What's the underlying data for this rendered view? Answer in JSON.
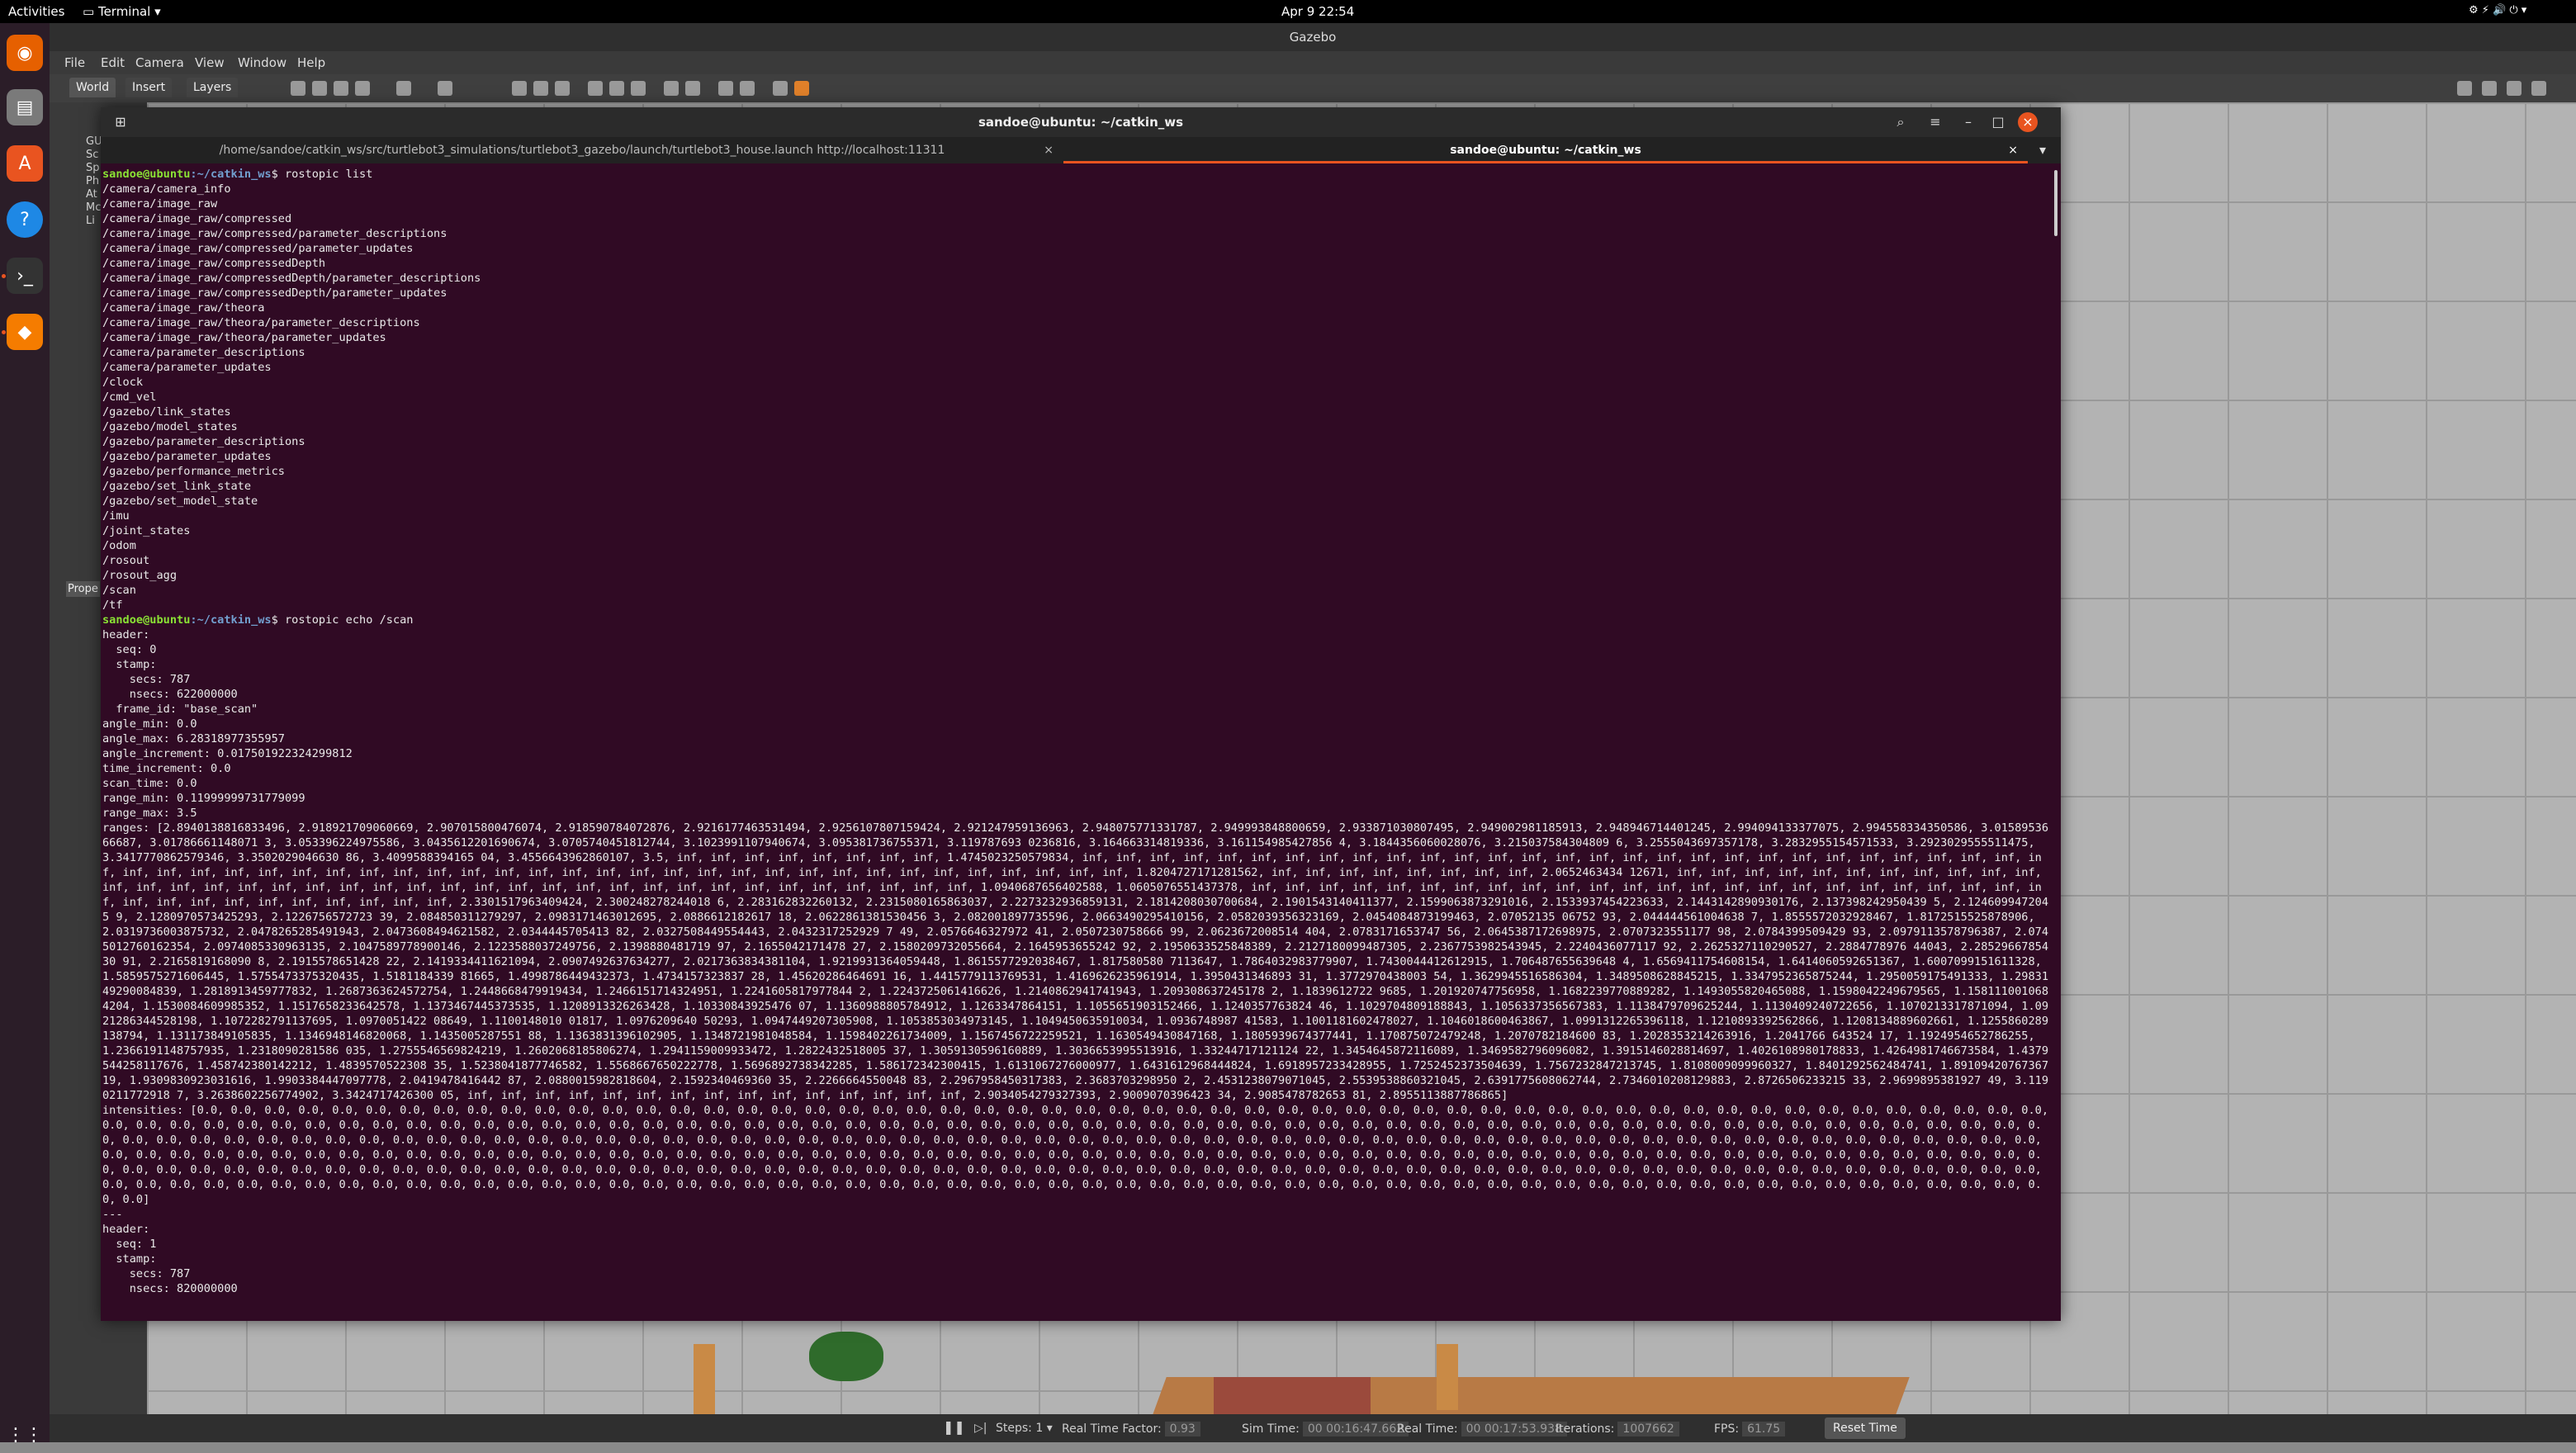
{
  "topbar": {
    "activities": "Activities",
    "app_menu": "Terminal ▾",
    "datetime": "Apr 9  22:54"
  },
  "gazebo": {
    "title": "Gazebo",
    "menus": [
      "File",
      "Edit",
      "Camera",
      "View",
      "Window",
      "Help"
    ],
    "tabs": [
      "World",
      "Insert",
      "Layers"
    ],
    "left_panel_items": [
      "GU",
      "Sc",
      "Sp",
      "Ph",
      "At",
      "Mc",
      "Li"
    ],
    "left_panel_label": "Prope",
    "status": {
      "steps_label": "Steps:",
      "steps_value": "1",
      "rtf_label": "Real Time Factor:",
      "rtf_value": "0.93",
      "sim_time_label": "Sim Time:",
      "sim_time_value": "00 00:16:47.662",
      "real_time_label": "Real Time:",
      "real_time_value": "00 00:17:53.938",
      "iterations_label": "Iterations:",
      "iterations_value": "1007662",
      "fps_label": "FPS:",
      "fps_value": "61.75",
      "reset_label": "Reset Time"
    }
  },
  "terminal": {
    "title": "sandoe@ubuntu: ~/catkin_ws",
    "tab1": "/home/sandoe/catkin_ws/src/turtlebot3_simulations/turtlebot3_gazebo/launch/turtlebot3_house.launch http://localhost:11311",
    "tab2": "sandoe@ubuntu: ~/catkin_ws",
    "prompt_user": "sandoe@ubuntu",
    "prompt_path": ":~/catkin_ws",
    "cmd1": "$ rostopic list",
    "topics": "/camera/camera_info\n/camera/image_raw\n/camera/image_raw/compressed\n/camera/image_raw/compressed/parameter_descriptions\n/camera/image_raw/compressed/parameter_updates\n/camera/image_raw/compressedDepth\n/camera/image_raw/compressedDepth/parameter_descriptions\n/camera/image_raw/compressedDepth/parameter_updates\n/camera/image_raw/theora\n/camera/image_raw/theora/parameter_descriptions\n/camera/image_raw/theora/parameter_updates\n/camera/parameter_descriptions\n/camera/parameter_updates\n/clock\n/cmd_vel\n/gazebo/link_states\n/gazebo/model_states\n/gazebo/parameter_descriptions\n/gazebo/parameter_updates\n/gazebo/performance_metrics\n/gazebo/set_link_state\n/gazebo/set_model_state\n/imu\n/joint_states\n/odom\n/rosout\n/rosout_agg\n/scan\n/tf",
    "cmd2": "$ rostopic echo /scan",
    "header1": "header:\n  seq: 0\n  stamp:\n    secs: 787\n    nsecs: 622000000\n  frame_id: \"base_scan\"\nangle_min: 0.0\nangle_max: 6.28318977355957\nangle_increment: 0.017501922324299812\ntime_increment: 0.0\nscan_time: 0.0\nrange_min: 0.11999999731779099\nrange_max: 3.5",
    "ranges": "ranges: [2.8940138816833496, 2.918921709060669, 2.907015800476074, 2.918590784072876, 2.9216177463531494, 2.9256107807159424, 2.921247959136963, 2.948075771331787, 2.949993848800659, 2.933871030807495, 2.949002981185913, 2.948946714401245, 2.994094133377075, 2.994558334350586, 3.0158953666687, 3.01786661148071 3, 3.053396224975586, 3.0435612201690674, 3.0705740451812744, 3.1023991107940674, 3.095381736755371, 3.119787693 0236816, 3.164663314819336, 3.161154985427856 4, 3.1844356060028076, 3.215037584304809 6, 3.2555043697357178, 3.2832955154571533, 3.2923029555511475, 3.3417770862579346, 3.3502029046630 86, 3.4099588394165 04, 3.4556643962860107, 3.5, inf, inf, inf, inf, inf, inf, inf, inf, 1.4745023250579834, inf, inf, inf, inf, inf, inf, inf, inf, inf, inf, inf, inf, inf, inf, inf, inf, inf, inf, inf, inf, inf, inf, inf, inf, inf, inf, inf, inf, inf, inf, inf, inf, inf, inf, inf, inf, inf, inf, inf, inf, inf, inf, inf, inf, inf, inf, inf, inf, inf, inf, inf, inf, inf, inf, inf, inf, inf, inf, inf, 1.8204727171281562, inf, inf, inf, inf, inf, inf, inf, inf, 2.0652463434 12671, inf, inf, inf, inf, inf, inf, inf, inf, inf, inf, inf, inf, inf, inf, inf, inf, inf, inf, inf, inf, inf, inf, inf, inf, inf, inf, inf, inf, inf, inf, inf, inf, inf, inf, inf, inf, inf, 1.0940687656402588, 1.0605076551437378, inf, inf, inf, inf, inf, inf, inf, inf, inf, inf, inf, inf, inf, inf, inf, inf, inf, inf, inf, inf, inf, inf, inf, inf, inf, inf, inf, inf, inf, inf, inf, inf, inf, inf, 2.3301517963409424, 2.300248278244018 6, 2.283162832260132, 2.2315080165863037, 2.2273232936859131, 2.1814208030700684, 2.1901543140411377, 2.1599063873291016, 2.1533937454223633, 2.1443142890930176, 2.137398242950439 5, 2.1246099472045 9, 2.1280970573425293, 2.1226756572723 39, 2.084850311279297, 2.0983171463012695, 2.0886612182617 18, 2.0622861381530456 3, 2.082001897735596, 2.0663490295410156, 2.0582039356323169, 2.0454084873199463, 2.07052135 06752 93, 2.044444561004638 7, 1.8555572032928467, 1.8172515525878906, 2.0319736003875732, 2.0478265285491943, 2.0473608494621582, 2.0344445705413 82, 2.0327508449554443, 2.0432317252929 7 49, 2.0576646327972 41, 2.0507230758666 99, 2.0623672008514 404, 2.0783171653747 56, 2.0645387172698975, 2.0707323551177 98, 2.0784399509429 93, 2.0979113578796387, 2.0745012760162354, 2.0974085330963135, 2.1047589778900146, 2.1223588037249756, 2.1398880481719 97, 2.1655042171478 27, 2.1580209732055664, 2.1645953655242 92, 2.1950633525848389, 2.2127180099487305, 2.2367753982543945, 2.2240436077117 92, 2.2625327110290527, 2.2884778976 44043, 2.2852966785430 91, 2.2165819168090 8, 2.1915578651428 22, 2.1419334411621094, 2.0907492637634277, 2.0217363834381104, 1.9219931364059448, 1.8615577292038467, 1.817580580 7113647, 1.7864032983779907, 1.7430044412612915, 1.706487655639648 4, 1.6569411754608154, 1.6414060592651367, 1.6007099151611328, 1.5859575271606445, 1.5755473375320435, 1.5181184339 81665, 1.4998786449432373, 1.4734157323837 28, 1.45620286464691 16, 1.4415779113769531, 1.4169626235961914, 1.3950431346893 31, 1.3772970438003 54, 1.3629945516586304, 1.3489508628845215, 1.3347952365875244, 1.2950059175491333, 1.2983149290084839, 1.2818913459777832, 1.2687363624572754, 1.2448668479919434, 1.2466151714324951, 1.2241605817977844 2, 1.2243725061416626, 1.2140862941741943, 1.209308637245178 2, 1.1839612722 9685, 1.201920747756958, 1.1682239770889282, 1.1493055820465088, 1.1598042249679565, 1.1581110010684204, 1.1530084609985352, 1.1517658233642578, 1.1373467445373535, 1.1208913326263428, 1.10330843925476 07, 1.1360988805784912, 1.1263347864151, 1.1055651903152466, 1.1240357763824 46, 1.1029704809188843, 1.1056337356567383, 1.1138479709625244, 1.1130409240722656, 1.1070213317871094, 1.0921286344528198, 1.1072282791137695, 1.0970051422 08649, 1.1100148010 01817, 1.0976209640 50293, 1.0947449207305908, 1.1053853034973145, 1.1049450635910034, 1.0936748987 41583, 1.1001181602478027, 1.1046018600463867, 1.0991312265396118, 1.1210893392562866, 1.1208134889602661, 1.1255860289138794, 1.131173849105835, 1.1346948146820068, 1.1435005287551 88, 1.1363831396102905, 1.1348721981048584, 1.1598402261734009, 1.1567456722259521, 1.1630549430847168, 1.1805939674377441, 1.170875072479248, 1.2070782184600 83, 1.2028353214263916, 1.2041766 643524 17, 1.1924954652786255, 1.2366191148757935, 1.2318090281586 035, 1.2755546569824219, 1.2602068185806274, 1.2941159009933472, 1.2822432518005 37, 1.3059130596160889, 1.3036653995513916, 1.33244717121124 22, 1.3454645872116089, 1.3469582796096082, 1.3915146028814697, 1.4026108980178833, 1.4264981746673584, 1.4379544258117676, 1.458742380142212, 1.4839570522308 35, 1.5238041877746582, 1.5568667650222778, 1.5696892738342285, 1.586172342300415, 1.6131067276000977, 1.6431612968444824, 1.6918957233428955, 1.7252452373504639, 1.7567232847213745, 1.8108009099960327, 1.8401292562484741, 1.8910942076736719, 1.9309830923031616, 1.9903384447097778, 2.0419478416442 87, 2.0880015982818604, 2.1592340469360 35, 2.2266664550048 83, 2.2967958450317383, 2.3683703298950 2, 2.4531238079071045, 2.5539538860321045, 2.6391775608062744, 2.7346010208129883, 2.8726506233215 33, 2.9699895381927 49, 3.1190211772918 7, 3.2638602256774902, 3.3424717426300 05, inf, inf, inf, inf, inf, inf, inf, inf, inf, inf, inf, inf, inf, inf, inf, 2.9034054279327393, 2.9009070396423 34, 2.9085478782653 81, 2.8955113887786865]",
    "intensities": "intensities: [0.0, 0.0, 0.0, 0.0, 0.0, 0.0, 0.0, 0.0, 0.0, 0.0, 0.0, 0.0, 0.0, 0.0, 0.0, 0.0, 0.0, 0.0, 0.0, 0.0, 0.0, 0.0, 0.0, 0.0, 0.0, 0.0, 0.0, 0.0, 0.0, 0.0, 0.0, 0.0, 0.0, 0.0, 0.0, 0.0, 0.0, 0.0, 0.0, 0.0, 0.0, 0.0, 0.0, 0.0, 0.0, 0.0, 0.0, 0.0, 0.0, 0.0, 0.0, 0.0, 0.0, 0.0, 0.0, 0.0, 0.0, 0.0, 0.0, 0.0, 0.0, 0.0, 0.0, 0.0, 0.0, 0.0, 0.0, 0.0, 0.0, 0.0, 0.0, 0.0, 0.0, 0.0, 0.0, 0.0, 0.0, 0.0, 0.0, 0.0, 0.0, 0.0, 0.0, 0.0, 0.0, 0.0, 0.0, 0.0, 0.0, 0.0, 0.0, 0.0, 0.0, 0.0, 0.0, 0.0, 0.0, 0.0, 0.0, 0.0, 0.0, 0.0, 0.0, 0.0, 0.0, 0.0, 0.0, 0.0, 0.0, 0.0, 0.0, 0.0, 0.0, 0.0, 0.0, 0.0, 0.0, 0.0, 0.0, 0.0, 0.0, 0.0, 0.0, 0.0, 0.0, 0.0, 0.0, 0.0, 0.0, 0.0, 0.0, 0.0, 0.0, 0.0, 0.0, 0.0, 0.0, 0.0, 0.0, 0.0, 0.0, 0.0, 0.0, 0.0, 0.0, 0.0, 0.0, 0.0, 0.0, 0.0, 0.0, 0.0, 0.0, 0.0, 0.0, 0.0, 0.0, 0.0, 0.0, 0.0, 0.0, 0.0, 0.0, 0.0, 0.0, 0.0, 0.0, 0.0, 0.0, 0.0, 0.0, 0.0, 0.0, 0.0, 0.0, 0.0, 0.0, 0.0, 0.0, 0.0, 0.0, 0.0, 0.0, 0.0, 0.0, 0.0, 0.0, 0.0, 0.0, 0.0, 0.0, 0.0, 0.0, 0.0, 0.0, 0.0, 0.0, 0.0, 0.0, 0.0, 0.0, 0.0, 0.0, 0.0, 0.0, 0.0, 0.0, 0.0, 0.0, 0.0, 0.0, 0.0, 0.0, 0.0, 0.0, 0.0, 0.0, 0.0, 0.0, 0.0, 0.0, 0.0, 0.0, 0.0, 0.0, 0.0, 0.0, 0.0, 0.0, 0.0, 0.0, 0.0, 0.0, 0.0, 0.0, 0.0, 0.0, 0.0, 0.0, 0.0, 0.0, 0.0, 0.0, 0.0, 0.0, 0.0, 0.0, 0.0, 0.0, 0.0, 0.0, 0.0, 0.0, 0.0, 0.0, 0.0, 0.0, 0.0, 0.0, 0.0, 0.0, 0.0, 0.0, 0.0, 0.0, 0.0, 0.0, 0.0, 0.0, 0.0, 0.0, 0.0, 0.0, 0.0, 0.0, 0.0, 0.0, 0.0, 0.0, 0.0, 0.0, 0.0, 0.0, 0.0, 0.0, 0.0, 0.0, 0.0, 0.0, 0.0, 0.0, 0.0, 0.0, 0.0, 0.0, 0.0, 0.0, 0.0, 0.0, 0.0, 0.0, 0.0, 0.0, 0.0, 0.0, 0.0, 0.0, 0.0, 0.0, 0.0, 0.0, 0.0, 0.0, 0.0, 0.0, 0.0, 0.0, 0.0, 0.0, 0.0, 0.0, 0.0, 0.0, 0.0, 0.0, 0.0, 0.0, 0.0, 0.0, 0.0, 0.0, 0.0, 0.0, 0.0, 0.0, 0.0, 0.0, 0.0, 0.0, 0.0, 0.0, 0.0, 0.0, 0.0]",
    "separator": "---",
    "header2": "header:\n  seq: 1\n  stamp:\n    secs: 787\n    nsecs: 820000000"
  }
}
